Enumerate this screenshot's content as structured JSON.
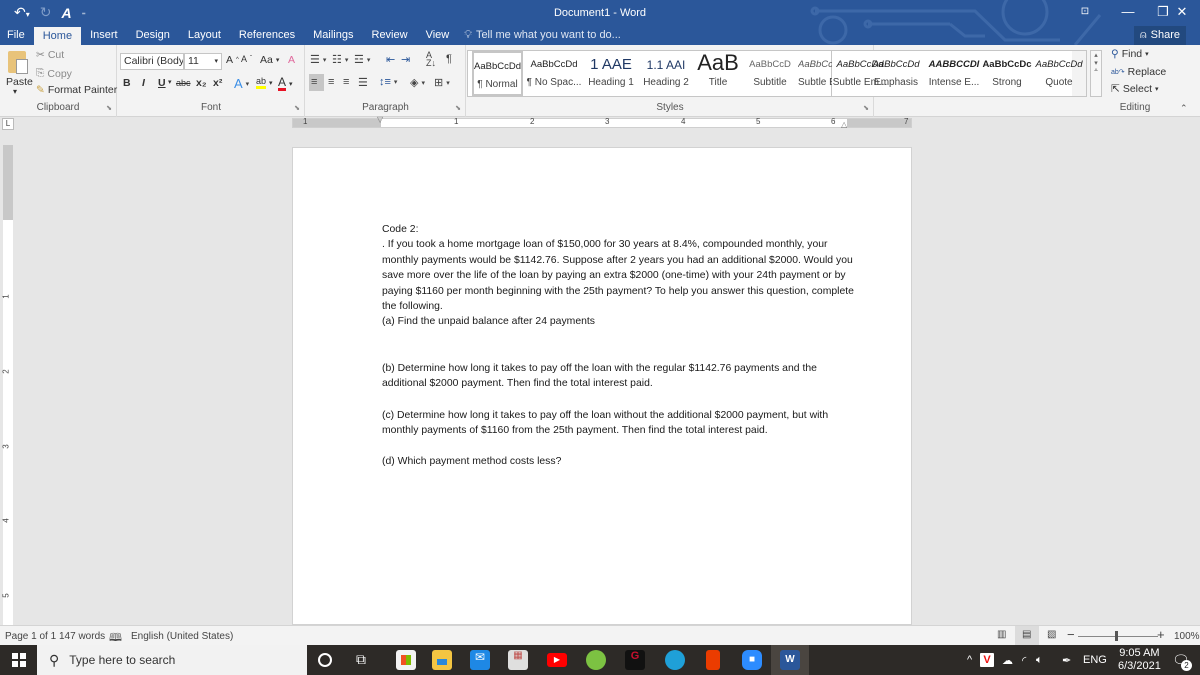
{
  "window": {
    "title": "Document1 - Word",
    "controls": {
      "ribbon_display": "ribbon-display-options-icon",
      "minimize": "—",
      "restore": "❐",
      "close": "✕"
    },
    "share_label": "Share"
  },
  "qat": {
    "undo": "undo-icon",
    "redo": "redo-icon",
    "spelling": "spelling-grammar-icon",
    "customize": "customize-qat-icon"
  },
  "tabs": [
    "File",
    "Home",
    "Insert",
    "Design",
    "Layout",
    "References",
    "Mailings",
    "Review",
    "View"
  ],
  "active_tab": "Home",
  "tell_me": "Tell me what you want to do...",
  "ribbon": {
    "clipboard": {
      "label": "Clipboard",
      "paste": "Paste",
      "cut": "Cut",
      "copy": "Copy",
      "format_painter": "Format Painter"
    },
    "font": {
      "label": "Font",
      "font_name": "Calibri (Body)",
      "font_size": "11",
      "change_case": "Aa",
      "bold": "B",
      "italic": "I",
      "underline": "U",
      "strikethrough": "abc",
      "subscript": "x₂",
      "superscript": "x²",
      "highlight_color": "#ffff00",
      "font_color": "#e81123"
    },
    "paragraph": {
      "label": "Paragraph"
    },
    "styles": {
      "label": "Styles",
      "items": [
        {
          "preview": "AaBbCcDd",
          "name": "¶ Normal"
        },
        {
          "preview": "AaBbCcDd",
          "name": "¶ No Spac..."
        },
        {
          "preview": "1 AAE",
          "name": "Heading 1"
        },
        {
          "preview": "1.1 AAI",
          "name": "Heading 2"
        },
        {
          "preview": "AaB",
          "name": "Title"
        },
        {
          "preview": "AaBbCcD",
          "name": "Subtitle"
        },
        {
          "preview": "AaBbCcDd",
          "name": "Subtle Em..."
        },
        {
          "preview": "AaBbCcDd",
          "name": "Emphasis"
        },
        {
          "preview": "AABBCCDI",
          "name": "Intense E..."
        },
        {
          "preview": "AaBbCcDc",
          "name": "Strong"
        },
        {
          "preview": "AaBbCcDd",
          "name": "Quote"
        }
      ],
      "selected": "¶ Normal"
    },
    "editing": {
      "label": "Editing",
      "find": "Find",
      "replace": "Replace",
      "select": "Select"
    }
  },
  "ruler": {
    "tab_selector": "L",
    "h_numbers": [
      "1",
      "1",
      "2",
      "3",
      "4",
      "5",
      "6",
      "7"
    ],
    "v_numbers": [
      "1",
      "2",
      "3",
      "4",
      "5"
    ]
  },
  "document": {
    "paragraphs": [
      "Code 2:",
      ". If you took a home mortgage loan of $150,000 for 30 years at 8.4%, compounded monthly, your monthly payments would be $1142.76. Suppose after 2 years you had an additional $2000. Would you save more over the life of the loan by paying an extra $2000 (one-time) with your 24th payment or by paying $1160 per month beginning with the 25th payment? To help you answer this question, complete the following.",
      "(a)  Find the unpaid balance after 24 payments",
      "(b)  Determine how long it takes to pay off the loan with the regular $1142.76 payments and the additional $2000 payment. Then find the total interest paid.",
      "(c)  Determine how long it takes to pay off the loan without the additional $2000 payment, but with monthly payments of $1160 from the 25th payment. Then find the total interest paid.",
      "(d)  Which payment method costs less?"
    ]
  },
  "status": {
    "page": "Page 1 of 1",
    "words": "147 words",
    "language": "English (United States)",
    "zoom": "100%",
    "zoom_minus": "−",
    "zoom_plus": "+"
  },
  "taskbar": {
    "search_placeholder": "Type here to search",
    "apps": [
      {
        "name": "cortana",
        "color": "#ffffff"
      },
      {
        "name": "task-view",
        "color": "#ffffff"
      },
      {
        "name": "microsoft-store",
        "color": "#f3f3f3"
      },
      {
        "name": "file-explorer",
        "color": "#f4c542"
      },
      {
        "name": "mail",
        "color": "#1e88e5"
      },
      {
        "name": "app-grid",
        "color": "#d9534f"
      },
      {
        "name": "youtube",
        "color": "#ff0000"
      },
      {
        "name": "recorder",
        "color": "#7cc242"
      },
      {
        "name": "garena",
        "color": "#c8102e"
      },
      {
        "name": "edge",
        "color": "#1fa0d8"
      },
      {
        "name": "office",
        "color": "#eb3c00"
      },
      {
        "name": "zoom",
        "color": "#2d8cff"
      },
      {
        "name": "word",
        "color": "#2b579a"
      }
    ],
    "tray": {
      "language": "ENG",
      "time": "9:05 AM",
      "date": "6/3/2021",
      "notifications": "2"
    }
  }
}
